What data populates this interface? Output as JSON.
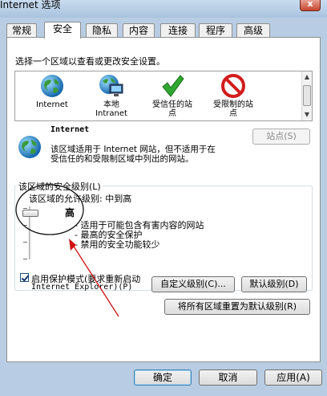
{
  "window": {
    "title": "Internet 选项",
    "close_label": "x"
  },
  "tabs": [
    {
      "label": "常规",
      "active": false
    },
    {
      "label": "安全",
      "active": true
    },
    {
      "label": "隐私",
      "active": false
    },
    {
      "label": "内容",
      "active": false
    },
    {
      "label": "连接",
      "active": false
    },
    {
      "label": "程序",
      "active": false
    },
    {
      "label": "高级",
      "active": false
    }
  ],
  "security": {
    "select_prompt": "选择一个区域以查看或更改安全设置。",
    "zones": [
      {
        "line1": "Internet",
        "line2": "",
        "icon": "globe-icon"
      },
      {
        "line1": "本地",
        "line2": "Intranet",
        "icon": "intranet-icon"
      },
      {
        "line1": "受信任的站",
        "line2": "点",
        "icon": "checkmark-icon"
      },
      {
        "line1": "受限制的站",
        "line2": "点",
        "icon": "restricted-icon"
      }
    ],
    "zone_info": {
      "name": "Internet",
      "desc_line1": "该区域适用于 Internet 网站，但不适用于在",
      "desc_line2": "受信任的和受限制区域中列出的网站。",
      "sites_button": "站点(S)"
    },
    "level_group": {
      "title": "该区域的安全级别(L)",
      "allowed": "该区域的允许级别: 中到高",
      "level_name": "高",
      "bullets": [
        "- 适用于可能包含有害内容的网站",
        "- 最高的安全保护",
        "- 禁用的安全功能较少"
      ],
      "protected_mode_line1": "启用保护模式(要求重新启动",
      "protected_mode_line2": "Internet Explorer)(P)",
      "protected_mode_checked": true,
      "custom_button": "自定义级别(C)...",
      "default_button": "默认级别(D)"
    },
    "reset_all_button": "将所有区域重置为默认级别(R)"
  },
  "footer": {
    "ok": "确定",
    "cancel": "取消",
    "apply": "应用(A)"
  },
  "colors": {
    "annotation": "#d01010",
    "selection": "#3399ff"
  }
}
